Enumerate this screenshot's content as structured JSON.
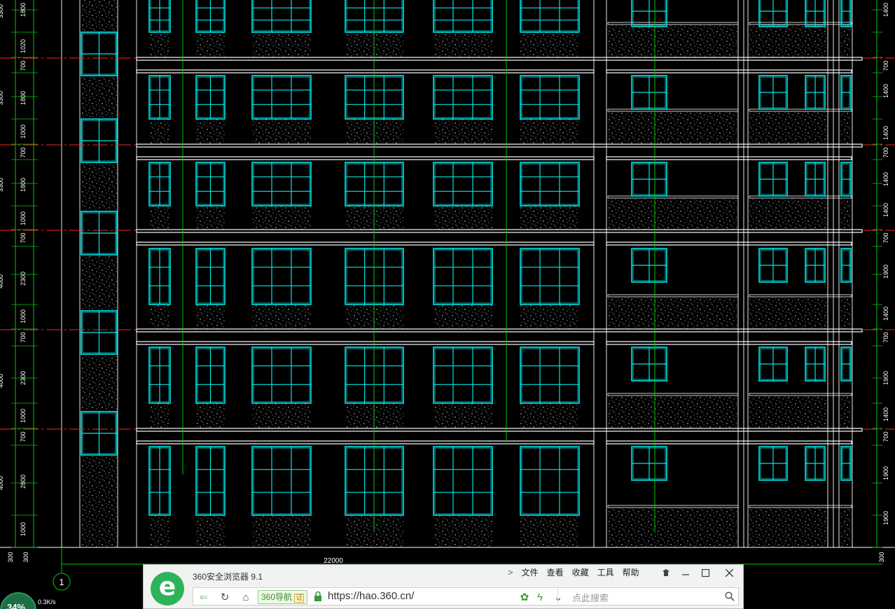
{
  "drawing": {
    "bottom_dimension": "22000",
    "axis_label": "1",
    "left_dims_top_to_bottom": [
      "1800",
      "1020",
      "700",
      "1800",
      "1000",
      "700",
      "1800",
      "1000",
      "700",
      "2300",
      "1000",
      "700",
      "2300",
      "1000",
      "700",
      "2800",
      "1000"
    ],
    "left_level_dims": [
      "3300",
      "3300",
      "3300",
      "4000",
      "4000",
      "4000"
    ],
    "right_dims_top_to_bottom": [
      "1400",
      "700",
      "1400",
      "1400",
      "700",
      "1400",
      "1400",
      "700",
      "1900",
      "1400",
      "700",
      "1900",
      "1400",
      "700",
      "1900",
      "1900"
    ],
    "bottom_left_dims": [
      "300",
      "300"
    ],
    "bottom_right_dims": [
      "300"
    ]
  },
  "browser": {
    "title": "360安全浏览器 9.1",
    "menu": [
      "文件",
      "查看",
      "收藏",
      "工具",
      "帮助"
    ],
    "nav_badge": "360导航",
    "cert_badge": "证",
    "url": "https://hao.360.cn/",
    "search_placeholder": "点此搜索"
  },
  "taskbar": {
    "percent": "34%",
    "speed": "0.3K/s"
  },
  "colors": {
    "window_frame": "#00e5e5",
    "guide": "#00c800",
    "level_line": "#ff2020",
    "slab": "#ffffff",
    "dims": "#00c800"
  }
}
